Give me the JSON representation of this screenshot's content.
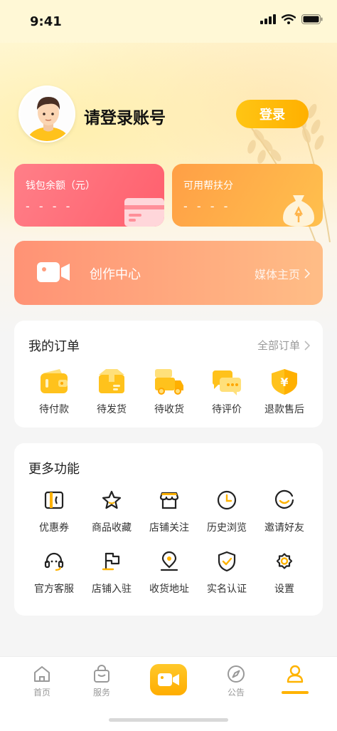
{
  "status_bar": {
    "time": "9:41"
  },
  "profile": {
    "title": "请登录账号",
    "login_label": "登录"
  },
  "cards": {
    "wallet": {
      "label": "钱包余额（元）",
      "value": "- - - -"
    },
    "points": {
      "label": "可用帮扶分",
      "value": "- - - -"
    }
  },
  "creator": {
    "title": "创作中心",
    "link": "媒体主页"
  },
  "orders": {
    "title": "我的订单",
    "link": "全部订单",
    "items": [
      {
        "label": "待付款",
        "icon": "wallet-icon"
      },
      {
        "label": "待发货",
        "icon": "package-icon"
      },
      {
        "label": "待收货",
        "icon": "truck-icon"
      },
      {
        "label": "待评价",
        "icon": "chat-icon"
      },
      {
        "label": "退款售后",
        "icon": "refund-shield-icon"
      }
    ]
  },
  "more": {
    "title": "更多功能",
    "items": [
      {
        "label": "优惠券",
        "icon": "coupon-icon"
      },
      {
        "label": "商品收藏",
        "icon": "star-icon"
      },
      {
        "label": "店铺关注",
        "icon": "store-icon"
      },
      {
        "label": "历史浏览",
        "icon": "clock-icon"
      },
      {
        "label": "邀请好友",
        "icon": "smile-icon"
      },
      {
        "label": "官方客服",
        "icon": "headset-icon"
      },
      {
        "label": "店铺入驻",
        "icon": "flag-icon"
      },
      {
        "label": "收货地址",
        "icon": "location-icon"
      },
      {
        "label": "实名认证",
        "icon": "verified-shield-icon"
      },
      {
        "label": "设置",
        "icon": "gear-icon"
      }
    ]
  },
  "tabs": [
    {
      "label": "首页",
      "icon": "home-icon"
    },
    {
      "label": "服务",
      "icon": "bag-icon"
    },
    {
      "label": "",
      "icon": "video-icon"
    },
    {
      "label": "公告",
      "icon": "compass-icon"
    },
    {
      "label": "",
      "icon": "user-icon"
    }
  ],
  "colors": {
    "accent": "#ffb300",
    "wallet": "#ff6b77",
    "points": "#ffae48",
    "creator": "#ffa07e"
  }
}
